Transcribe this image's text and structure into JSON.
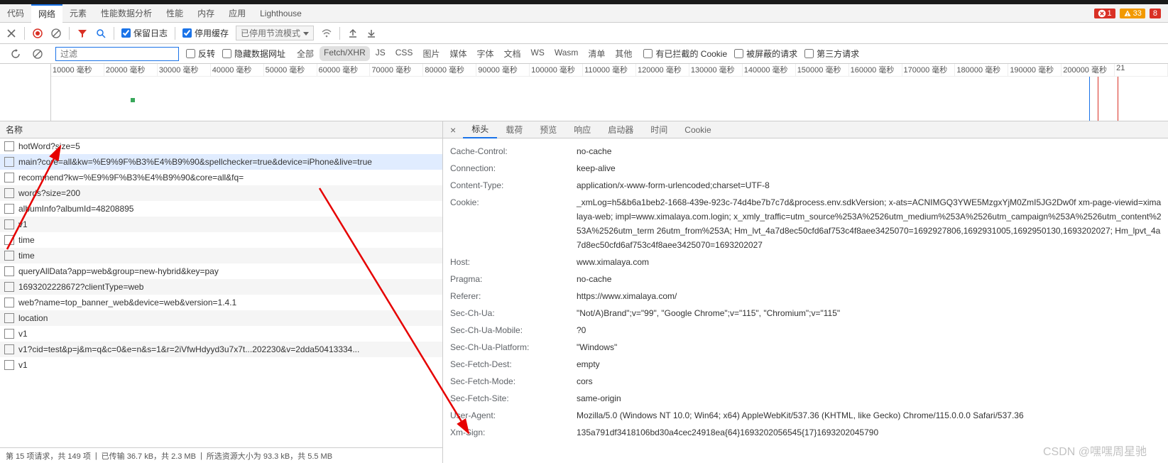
{
  "topTabs": [
    "代码",
    "网络",
    "元素",
    "性能数据分析",
    "性能",
    "内存",
    "应用",
    "Lighthouse"
  ],
  "activeTopTab": 1,
  "badges": {
    "errors": "1",
    "warnings": "33",
    "red2": "8"
  },
  "toolbar": {
    "preserveLog": "保留日志",
    "disableCache": "停用缓存",
    "throttling": "已停用节流模式"
  },
  "filter": {
    "placeholder": "过滤",
    "invert": "反转",
    "hideDataUrls": "隐藏数据网址",
    "types": [
      "全部",
      "Fetch/XHR",
      "JS",
      "CSS",
      "图片",
      "媒体",
      "字体",
      "文档",
      "WS",
      "Wasm",
      "清单",
      "其他"
    ],
    "activeType": 1,
    "blockedCookies": "有已拦截的 Cookie",
    "blockedRequests": "被屏蔽的请求",
    "thirdParty": "第三方请求"
  },
  "timeline": {
    "ticks": [
      "10000 毫秒",
      "20000 毫秒",
      "30000 毫秒",
      "40000 毫秒",
      "50000 毫秒",
      "60000 毫秒",
      "70000 毫秒",
      "80000 毫秒",
      "90000 毫秒",
      "100000 毫秒",
      "110000 毫秒",
      "120000 毫秒",
      "130000 毫秒",
      "140000 毫秒",
      "150000 毫秒",
      "160000 毫秒",
      "170000 毫秒",
      "180000 毫秒",
      "190000 毫秒",
      "200000 毫秒",
      "21"
    ]
  },
  "listHeader": "名称",
  "requests": [
    {
      "name": "hotWord?size=5"
    },
    {
      "name": "main?core=all&kw=%E9%9F%B3%E4%B9%90&spellchecker=true&device=iPhone&live=true",
      "sel": true
    },
    {
      "name": "recommend?kw=%E9%9F%B3%E4%B9%90&core=all&fq="
    },
    {
      "name": "words?size=200"
    },
    {
      "name": "albumInfo?albumId=48208895"
    },
    {
      "name": "v1"
    },
    {
      "name": "time"
    },
    {
      "name": "time"
    },
    {
      "name": "queryAllData?app=web&group=new-hybrid&key=pay"
    },
    {
      "name": "1693202228672?clientType=web"
    },
    {
      "name": "web?name=top_banner_web&device=web&version=1.4.1"
    },
    {
      "name": "location"
    },
    {
      "name": "v1"
    },
    {
      "name": "v1?cid=test&p=j&m=q&c=0&e=n&s=1&r=2iVfwHdyyd3u7x7t...202230&v=2dda50413334..."
    },
    {
      "name": "v1"
    }
  ],
  "footer": {
    "summary": "第 15 项请求，共 149 项",
    "transferred": "已传输 36.7 kB，共 2.3 MB",
    "resources": "所选资源大小为 93.3 kB，共 5.5 MB"
  },
  "detailTabs": [
    "标头",
    "载荷",
    "预览",
    "响应",
    "启动器",
    "时间",
    "Cookie"
  ],
  "activeDetailTab": 0,
  "headers": [
    {
      "k": "Cache-Control:",
      "v": "no-cache"
    },
    {
      "k": "Connection:",
      "v": "keep-alive"
    },
    {
      "k": "Content-Type:",
      "v": "application/x-www-form-urlencoded;charset=UTF-8"
    },
    {
      "k": "Cookie:",
      "v": "_xmLog=h5&b6a1beb2-1668-439e-923c-74d4be7b7c7d&process.env.sdkVersion; x-ats=ACNIMGQ3YWE5MzgxYjM0ZmI5JG2Dw0f xm-page-viewid=ximalaya-web; impl=www.ximalaya.com.login; x_xmly_traffic=utm_source%253A%2526utm_medium%253A%2526utm_campaign%253A%2526utm_content%253A%2526utm_term 26utm_from%253A; Hm_lvt_4a7d8ec50cfd6af753c4f8aee3425070=1692927806,1692931005,1692950130,1693202027; Hm_lpvt_4a7d8ec50cfd6af753c4f8aee3425070=1693202027"
    },
    {
      "k": "Host:",
      "v": "www.ximalaya.com"
    },
    {
      "k": "Pragma:",
      "v": "no-cache"
    },
    {
      "k": "Referer:",
      "v": "https://www.ximalaya.com/"
    },
    {
      "k": "Sec-Ch-Ua:",
      "v": "\"Not/A)Brand\";v=\"99\", \"Google Chrome\";v=\"115\", \"Chromium\";v=\"115\""
    },
    {
      "k": "Sec-Ch-Ua-Mobile:",
      "v": "?0"
    },
    {
      "k": "Sec-Ch-Ua-Platform:",
      "v": "\"Windows\""
    },
    {
      "k": "Sec-Fetch-Dest:",
      "v": "empty"
    },
    {
      "k": "Sec-Fetch-Mode:",
      "v": "cors"
    },
    {
      "k": "Sec-Fetch-Site:",
      "v": "same-origin"
    },
    {
      "k": "User-Agent:",
      "v": "Mozilla/5.0 (Windows NT 10.0; Win64; x64) AppleWebKit/537.36 (KHTML, like Gecko) Chrome/115.0.0.0 Safari/537.36"
    },
    {
      "k": "Xm-Sign:",
      "v": "135a791df3418106bd30a4cec24918ea{64}1693202056545{17}1693202045790"
    }
  ],
  "watermark": "CSDN @嘿嘿周星驰"
}
